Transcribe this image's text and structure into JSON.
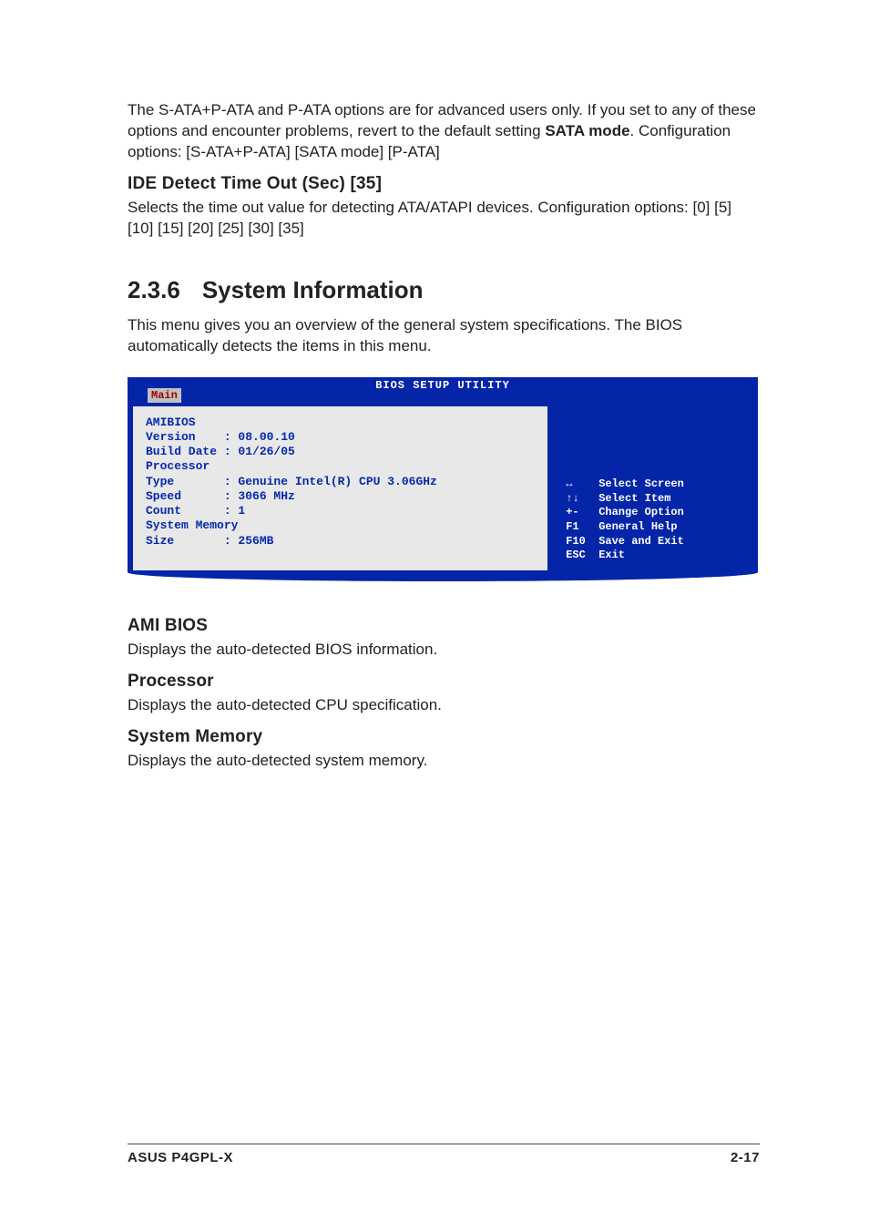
{
  "intro": {
    "p1_a": "The S-ATA+P-ATA and P-ATA options are for advanced users only. If you set to any of these options and encounter problems, revert to the default setting ",
    "p1_bold": "SATA mode",
    "p1_b": ". Configuration options: [S-ATA+P-ATA] [SATA mode] [P-ATA]"
  },
  "ide": {
    "heading": "IDE Detect Time Out (Sec) [35]",
    "p": "Selects the time out value for detecting ATA/ATAPI devices. Configuration options: [0] [5] [10] [15] [20] [25] [30] [35]"
  },
  "section": {
    "num": "2.3.6",
    "title": "System Information",
    "p": "This menu gives you an overview of the general system specifications. The BIOS automatically detects the items in this menu."
  },
  "bios": {
    "title": "BIOS SETUP UTILITY",
    "tab": "Main",
    "left": {
      "l1": "AMIBIOS",
      "l2": "Version    : 08.00.10",
      "l3": "Build Date : 01/26/05",
      "l4": "",
      "l5": "Processor",
      "l6": "Type       : Genuine Intel(R) CPU 3.06GHz",
      "l7": "Speed      : 3066 MHz",
      "l8": "Count      : 1",
      "l9": "",
      "l10": "System Memory",
      "l11": "Size       : 256MB"
    },
    "legend": {
      "l1": " ↔    Select Screen",
      "l2": " ↑↓   Select Item",
      "l3": " +-   Change Option",
      "l4": " F1   General Help",
      "l5": " F10  Save and Exit",
      "l6": " ESC  Exit"
    }
  },
  "below": {
    "h1": "AMI BIOS",
    "p1": "Displays the auto-detected BIOS information.",
    "h2": "Processor",
    "p2": "Displays the auto-detected CPU specification.",
    "h3": "System Memory",
    "p3": "Displays the auto-detected system memory."
  },
  "footer": {
    "left": "ASUS P4GPL-X",
    "right": "2-17"
  }
}
